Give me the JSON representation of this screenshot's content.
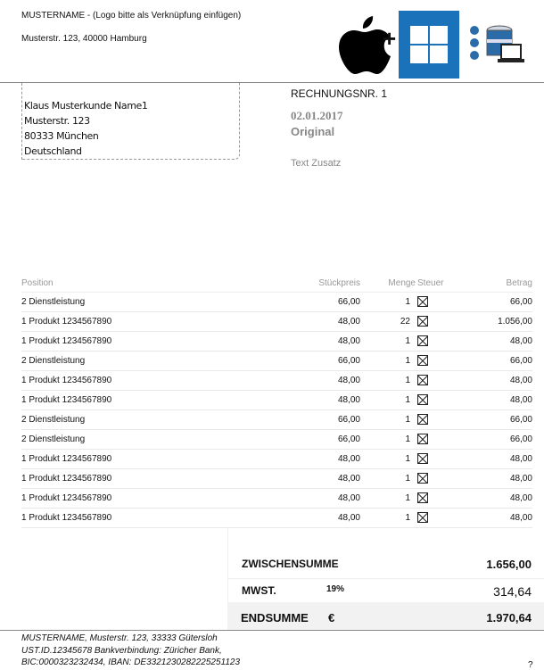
{
  "sender": {
    "name_line": "MUSTERNAME -  (Logo bitte als Verknüpfung einfügen)",
    "address_line": "Musterstr. 123, 40000 Hamburg"
  },
  "logo": {
    "plus": "+",
    "windows_color": "#1a72bb"
  },
  "recipient": [
    "Klaus Musterkunde Name1",
    "Musterstr. 123",
    "80333 München",
    "Deutschland"
  ],
  "invoice": {
    "number": "RECHNUNGSNR. 1",
    "date": "02.01.2017",
    "copy": "Original",
    "extra": "Text Zusatz"
  },
  "table": {
    "headers": {
      "position": "Position",
      "price": "Stückpreis",
      "qty": "Menge",
      "tax": "Steuer",
      "amount": "Betrag"
    },
    "rows": [
      {
        "position": "2 Dienstleistung",
        "price": "66,00",
        "qty": "1",
        "amount": "66,00"
      },
      {
        "position": "1 Produkt 1234567890",
        "price": "48,00",
        "qty": "22",
        "amount": "1.056,00"
      },
      {
        "position": "1 Produkt 1234567890",
        "price": "48,00",
        "qty": "1",
        "amount": "48,00"
      },
      {
        "position": "2 Dienstleistung",
        "price": "66,00",
        "qty": "1",
        "amount": "66,00"
      },
      {
        "position": "1 Produkt 1234567890",
        "price": "48,00",
        "qty": "1",
        "amount": "48,00"
      },
      {
        "position": "1 Produkt 1234567890",
        "price": "48,00",
        "qty": "1",
        "amount": "48,00"
      },
      {
        "position": "2 Dienstleistung",
        "price": "66,00",
        "qty": "1",
        "amount": "66,00"
      },
      {
        "position": "2 Dienstleistung",
        "price": "66,00",
        "qty": "1",
        "amount": "66,00"
      },
      {
        "position": "1 Produkt 1234567890",
        "price": "48,00",
        "qty": "1",
        "amount": "48,00"
      },
      {
        "position": "1 Produkt 1234567890",
        "price": "48,00",
        "qty": "1",
        "amount": "48,00"
      },
      {
        "position": "1 Produkt 1234567890",
        "price": "48,00",
        "qty": "1",
        "amount": "48,00"
      },
      {
        "position": "1 Produkt 1234567890",
        "price": "48,00",
        "qty": "1",
        "amount": "48,00"
      }
    ]
  },
  "totals": {
    "subtotal_label": "ZWISCHENSUMME",
    "subtotal": "1.656,00",
    "vat_label": "MWST.",
    "vat_rate": "19%",
    "vat": "314,64",
    "total_label": "ENDSUMME",
    "currency": "€",
    "total": "1.970,64"
  },
  "footer": {
    "lines": [
      "MUSTERNAME, Musterstr. 123, 33333 Gütersloh",
      "UST.ID.12345678 Bankverbindung: Züricher Bank,",
      "BIC:0000323232434, IBAN: DE3321230282225251123"
    ],
    "page": "?"
  }
}
